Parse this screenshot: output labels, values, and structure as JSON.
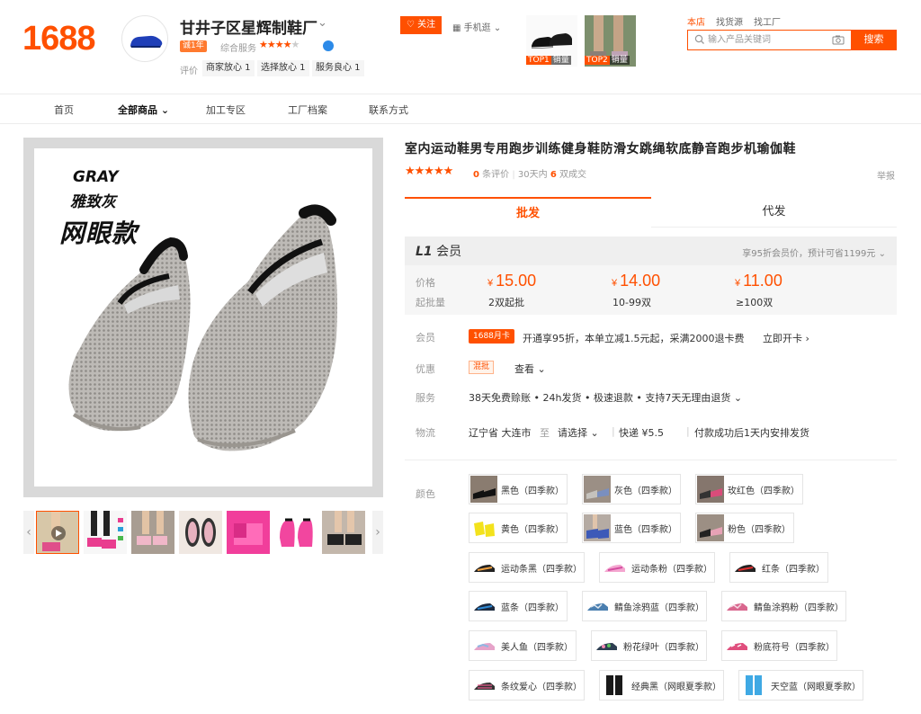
{
  "header": {
    "logo": "1688",
    "shop_name": "甘井子区星辉制鞋厂",
    "years_badge": "诚1年",
    "service_label": "综合服务",
    "service_stars": "★★★★",
    "service_star_off": "★",
    "rating_label": "评价",
    "rating_chips": [
      "商家放心 1",
      "选择放心 1",
      "服务良心 1"
    ],
    "follow_label": "关注",
    "mobile_shop_label": "手机逛",
    "top_items": [
      {
        "rank": "TOP1",
        "sales": "销量"
      },
      {
        "rank": "TOP2",
        "sales": "销量"
      }
    ],
    "search_tabs": [
      "本店",
      "找货源",
      "找工厂"
    ],
    "search_placeholder": "输入产品关键词",
    "search_button": "搜索"
  },
  "nav": {
    "items": [
      "首页",
      "全部商品",
      "加工专区",
      "工厂档案",
      "联系方式"
    ]
  },
  "gallery": {
    "overlay_en": "GRAY",
    "overlay_cn": "雅致灰",
    "overlay_type": "网眼款",
    "prev_icon": "‹",
    "next_icon": "›"
  },
  "product": {
    "title": "室内运动鞋男专用跑步训练健身鞋防滑女跳绳软底静音跑步机瑜伽鞋",
    "stars": "★★★★★",
    "review_count": "0",
    "review_label": "条评价",
    "days_label": "30天内",
    "sold_count": "6",
    "sold_label": "双成交",
    "report": "举报"
  },
  "tabs": {
    "wholesale": "批发",
    "dropship": "代发"
  },
  "member": {
    "level": "L1",
    "level_label": "会员",
    "hint": "享95折会员价，预计可省1199元"
  },
  "pricing": {
    "price_label": "价格",
    "moq_label": "起批量",
    "currency": "¥",
    "tiers": [
      {
        "price": "15.00",
        "moq": "2双起批"
      },
      {
        "price": "14.00",
        "moq": "10-99双"
      },
      {
        "price": "11.00",
        "moq": "≥100双"
      }
    ]
  },
  "member_row": {
    "label": "会员",
    "badge": "1688月卡",
    "text": "开通享95折，本单立减1.5元起，采满2000退卡费",
    "link": "立即开卡"
  },
  "discount_row": {
    "label": "优惠",
    "badge": "混批",
    "link": "查看"
  },
  "service_row": {
    "label": "服务",
    "text": "38天免费赊账 • 24h发货 • 极速退款 • 支持7天无理由退货"
  },
  "logistics_row": {
    "label": "物流",
    "origin": "辽宁省 大连市",
    "to": "至",
    "dest": "请选择",
    "express": "快递 ¥5.5",
    "ship_note": "付款成功后1天内安排发货"
  },
  "colors": {
    "label": "颜色",
    "options": [
      "黑色（四季款）",
      "灰色（四季款）",
      "玫红色（四季款）",
      "黄色（四季款）",
      "蓝色（四季款）",
      "粉色（四季款）",
      "运动条黑（四季款）",
      "运动条粉（四季款）",
      "红条（四季款）",
      "蓝条（四季款）",
      "鲭鱼涂鸦蓝（四季款）",
      "鲭鱼涂鸦粉（四季款）",
      "美人鱼（四季款）",
      "粉花绿叶（四季款）",
      "粉底符号（四季款）",
      "条纹爱心（四季款）",
      "经典黑（网眼夏季款）",
      "天空蓝（网眼夏季款）"
    ]
  },
  "colors_brand": {
    "accent": "#ff5000",
    "panel_gray": "#efefef"
  }
}
